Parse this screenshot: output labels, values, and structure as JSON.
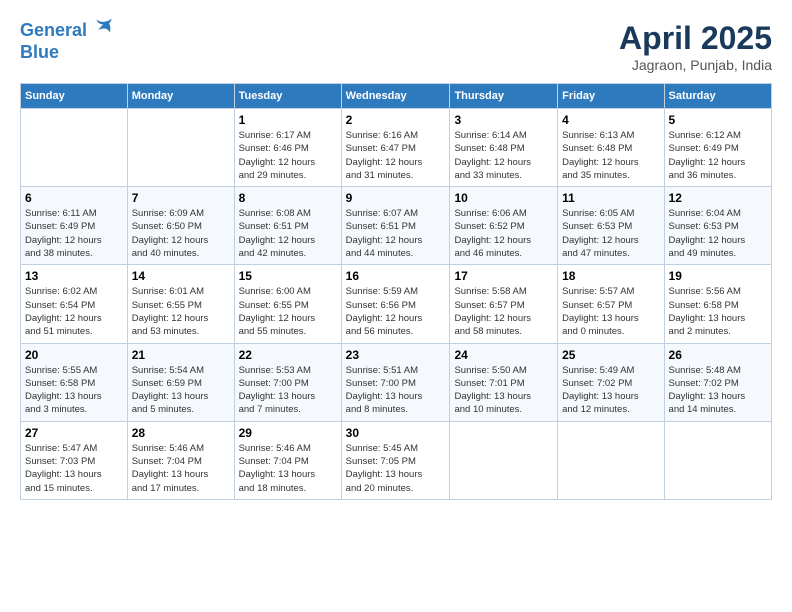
{
  "logo": {
    "line1": "General",
    "line2": "Blue"
  },
  "title": "April 2025",
  "location": "Jagraon, Punjab, India",
  "weekdays": [
    "Sunday",
    "Monday",
    "Tuesday",
    "Wednesday",
    "Thursday",
    "Friday",
    "Saturday"
  ],
  "weeks": [
    [
      {
        "day": "",
        "info": ""
      },
      {
        "day": "",
        "info": ""
      },
      {
        "day": "1",
        "info": "Sunrise: 6:17 AM\nSunset: 6:46 PM\nDaylight: 12 hours\nand 29 minutes."
      },
      {
        "day": "2",
        "info": "Sunrise: 6:16 AM\nSunset: 6:47 PM\nDaylight: 12 hours\nand 31 minutes."
      },
      {
        "day": "3",
        "info": "Sunrise: 6:14 AM\nSunset: 6:48 PM\nDaylight: 12 hours\nand 33 minutes."
      },
      {
        "day": "4",
        "info": "Sunrise: 6:13 AM\nSunset: 6:48 PM\nDaylight: 12 hours\nand 35 minutes."
      },
      {
        "day": "5",
        "info": "Sunrise: 6:12 AM\nSunset: 6:49 PM\nDaylight: 12 hours\nand 36 minutes."
      }
    ],
    [
      {
        "day": "6",
        "info": "Sunrise: 6:11 AM\nSunset: 6:49 PM\nDaylight: 12 hours\nand 38 minutes."
      },
      {
        "day": "7",
        "info": "Sunrise: 6:09 AM\nSunset: 6:50 PM\nDaylight: 12 hours\nand 40 minutes."
      },
      {
        "day": "8",
        "info": "Sunrise: 6:08 AM\nSunset: 6:51 PM\nDaylight: 12 hours\nand 42 minutes."
      },
      {
        "day": "9",
        "info": "Sunrise: 6:07 AM\nSunset: 6:51 PM\nDaylight: 12 hours\nand 44 minutes."
      },
      {
        "day": "10",
        "info": "Sunrise: 6:06 AM\nSunset: 6:52 PM\nDaylight: 12 hours\nand 46 minutes."
      },
      {
        "day": "11",
        "info": "Sunrise: 6:05 AM\nSunset: 6:53 PM\nDaylight: 12 hours\nand 47 minutes."
      },
      {
        "day": "12",
        "info": "Sunrise: 6:04 AM\nSunset: 6:53 PM\nDaylight: 12 hours\nand 49 minutes."
      }
    ],
    [
      {
        "day": "13",
        "info": "Sunrise: 6:02 AM\nSunset: 6:54 PM\nDaylight: 12 hours\nand 51 minutes."
      },
      {
        "day": "14",
        "info": "Sunrise: 6:01 AM\nSunset: 6:55 PM\nDaylight: 12 hours\nand 53 minutes."
      },
      {
        "day": "15",
        "info": "Sunrise: 6:00 AM\nSunset: 6:55 PM\nDaylight: 12 hours\nand 55 minutes."
      },
      {
        "day": "16",
        "info": "Sunrise: 5:59 AM\nSunset: 6:56 PM\nDaylight: 12 hours\nand 56 minutes."
      },
      {
        "day": "17",
        "info": "Sunrise: 5:58 AM\nSunset: 6:57 PM\nDaylight: 12 hours\nand 58 minutes."
      },
      {
        "day": "18",
        "info": "Sunrise: 5:57 AM\nSunset: 6:57 PM\nDaylight: 13 hours\nand 0 minutes."
      },
      {
        "day": "19",
        "info": "Sunrise: 5:56 AM\nSunset: 6:58 PM\nDaylight: 13 hours\nand 2 minutes."
      }
    ],
    [
      {
        "day": "20",
        "info": "Sunrise: 5:55 AM\nSunset: 6:58 PM\nDaylight: 13 hours\nand 3 minutes."
      },
      {
        "day": "21",
        "info": "Sunrise: 5:54 AM\nSunset: 6:59 PM\nDaylight: 13 hours\nand 5 minutes."
      },
      {
        "day": "22",
        "info": "Sunrise: 5:53 AM\nSunset: 7:00 PM\nDaylight: 13 hours\nand 7 minutes."
      },
      {
        "day": "23",
        "info": "Sunrise: 5:51 AM\nSunset: 7:00 PM\nDaylight: 13 hours\nand 8 minutes."
      },
      {
        "day": "24",
        "info": "Sunrise: 5:50 AM\nSunset: 7:01 PM\nDaylight: 13 hours\nand 10 minutes."
      },
      {
        "day": "25",
        "info": "Sunrise: 5:49 AM\nSunset: 7:02 PM\nDaylight: 13 hours\nand 12 minutes."
      },
      {
        "day": "26",
        "info": "Sunrise: 5:48 AM\nSunset: 7:02 PM\nDaylight: 13 hours\nand 14 minutes."
      }
    ],
    [
      {
        "day": "27",
        "info": "Sunrise: 5:47 AM\nSunset: 7:03 PM\nDaylight: 13 hours\nand 15 minutes."
      },
      {
        "day": "28",
        "info": "Sunrise: 5:46 AM\nSunset: 7:04 PM\nDaylight: 13 hours\nand 17 minutes."
      },
      {
        "day": "29",
        "info": "Sunrise: 5:46 AM\nSunset: 7:04 PM\nDaylight: 13 hours\nand 18 minutes."
      },
      {
        "day": "30",
        "info": "Sunrise: 5:45 AM\nSunset: 7:05 PM\nDaylight: 13 hours\nand 20 minutes."
      },
      {
        "day": "",
        "info": ""
      },
      {
        "day": "",
        "info": ""
      },
      {
        "day": "",
        "info": ""
      }
    ]
  ]
}
